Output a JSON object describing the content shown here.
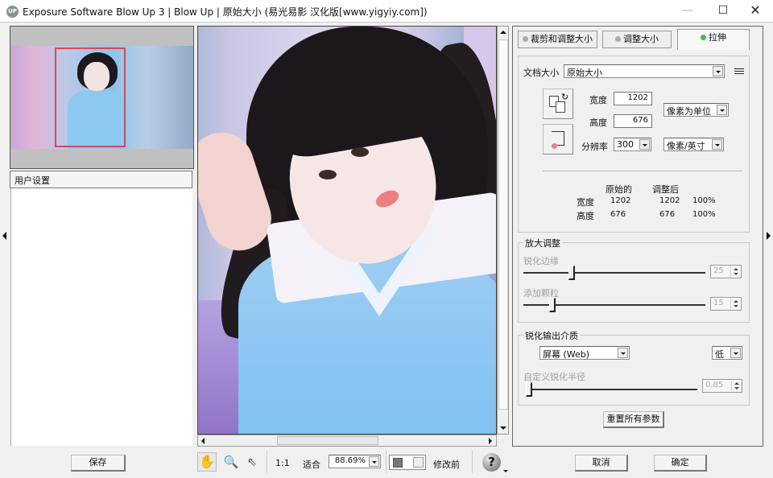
{
  "window": {
    "app_icon": "UP",
    "title": "Exposure Software Blow Up 3 | Blow Up | 原始大小   (易光易影 汉化版[www.yigyiy.com])",
    "minimize": "—",
    "maximize": "☐",
    "close": "✕"
  },
  "left_panel": {
    "user_settings_label": "用户设置",
    "save_button": "保存"
  },
  "tabs": [
    {
      "label": "裁剪和调整大小",
      "active": false
    },
    {
      "label": "调整大小",
      "active": false
    },
    {
      "label": "拉伸",
      "active": true
    }
  ],
  "document": {
    "doc_size_label": "文档大小",
    "doc_size_value": "原始大小",
    "width_label": "宽度",
    "width_value": "1202",
    "height_label": "高度",
    "height_value": "676",
    "resolution_label": "分辨率",
    "resolution_value": "300",
    "unit_value": "像素为单位",
    "res_unit_value": "像素/英寸"
  },
  "stats": {
    "col_original": "原始的",
    "col_adjusted": "调整后",
    "rows": [
      {
        "label": "宽度",
        "original": "1202",
        "adjusted": "1202",
        "percent": "100%"
      },
      {
        "label": "高度",
        "original": "676",
        "adjusted": "676",
        "percent": "100%"
      }
    ]
  },
  "enlarge": {
    "title": "放大调整",
    "sharpen_edges_label": "锐化边缘",
    "sharpen_edges_value": "25",
    "add_grain_label": "添加颗粒",
    "add_grain_value": "15"
  },
  "sharpen_output": {
    "title": "锐化输出介质",
    "medium_value": "屏幕 (Web)",
    "level_value": "低",
    "custom_radius_label": "自定义锐化半径",
    "custom_radius_value": "0.85",
    "reset_button": "重置所有参数"
  },
  "toolbar": {
    "one_to_one": "1:1",
    "fit": "适合",
    "zoom_value": "88.69%",
    "before_label": "修改前",
    "help": "?",
    "cancel_button": "取消",
    "ok_button": "确定"
  },
  "icons": {
    "hand": "✋",
    "magnifier": "🔍",
    "pointer": "⇖"
  }
}
